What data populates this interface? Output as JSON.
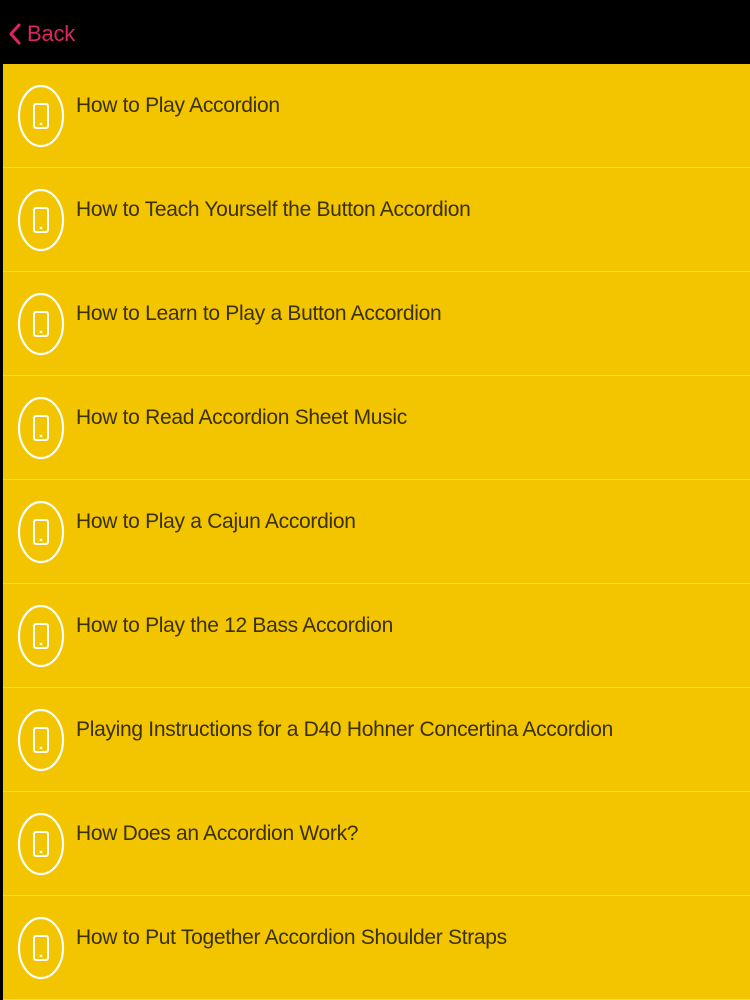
{
  "colors": {
    "navbar_background": "#000000",
    "back_accent": "#e0245e",
    "list_background": "#f2c500",
    "item_text": "#3a3000",
    "icon_stroke": "#ffffff"
  },
  "navbar": {
    "back_label": "Back",
    "back_icon": "chevron-left-icon"
  },
  "list": {
    "item_icon": "phone-icon",
    "items": [
      {
        "label": "How to Play Accordion"
      },
      {
        "label": "How to Teach Yourself the Button Accordion"
      },
      {
        "label": "How to Learn to Play a Button Accordion"
      },
      {
        "label": "How to Read Accordion Sheet Music"
      },
      {
        "label": "How to Play a Cajun Accordion"
      },
      {
        "label": "How to Play the 12 Bass Accordion"
      },
      {
        "label": "Playing Instructions for a D40 Hohner Concertina Accordion"
      },
      {
        "label": "How Does an Accordion Work?"
      },
      {
        "label": "How to Put Together Accordion Shoulder Straps"
      }
    ]
  }
}
